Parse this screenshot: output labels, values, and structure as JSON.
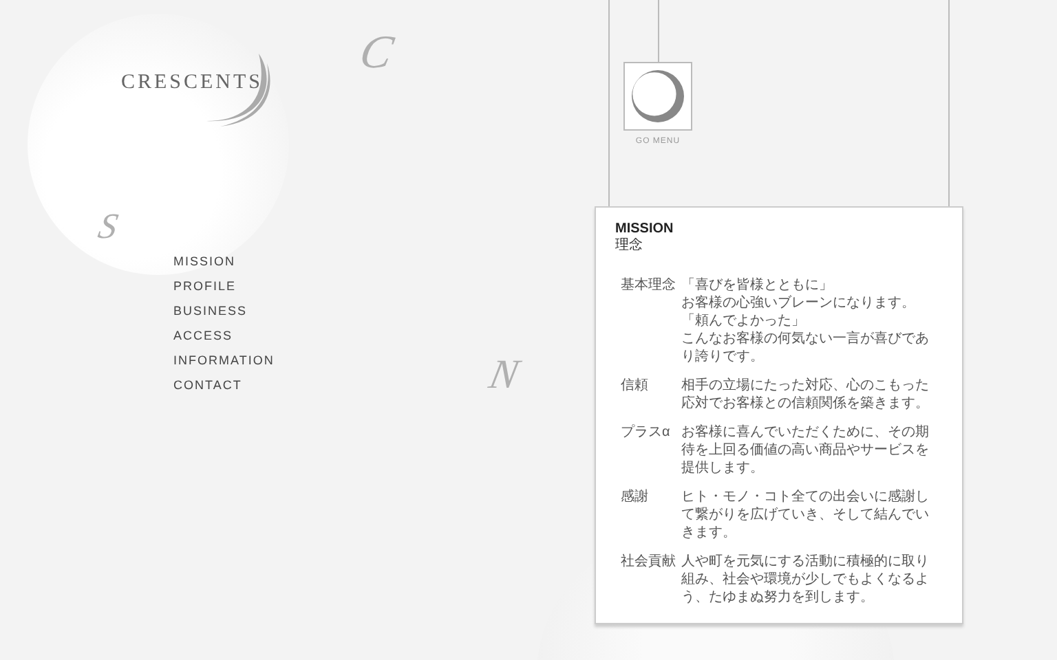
{
  "logo": {
    "text": "CRESCENTS"
  },
  "decor_letters": [
    {
      "letter": "C",
      "kind": "c"
    },
    {
      "letter": "S",
      "kind": "s"
    },
    {
      "letter": "N",
      "kind": "n"
    }
  ],
  "nav": [
    {
      "label": "MISSION"
    },
    {
      "label": "PROFILE"
    },
    {
      "label": "BUSINESS"
    },
    {
      "label": "ACCESS"
    },
    {
      "label": "INFORMATION"
    },
    {
      "label": "CONTACT"
    }
  ],
  "menu_button": {
    "label": "GO MENU"
  },
  "card": {
    "title": "MISSION",
    "subtitle": "理念",
    "rows": [
      {
        "label": "基本理念",
        "lines": [
          "「喜びを皆様とともに」",
          "お客様の心強いブレーンになります。",
          "「頼んでよかった」",
          "こんなお客様の何気ない一言が喜びであり誇りです。"
        ]
      },
      {
        "label": "信頼",
        "lines": [
          "相手の立場にたった対応、心のこもった応対でお客様との信頼関係を築きます。"
        ]
      },
      {
        "label": "プラスα",
        "lines": [
          "お客様に喜んでいただくために、その期待を上回る価値の高い商品やサービスを提供します。"
        ]
      },
      {
        "label": "感謝",
        "lines": [
          "ヒト・モノ・コト全ての出会いに感謝して繋がりを広げていき、そして結んでいきます。"
        ]
      },
      {
        "label": "社会貢献",
        "lines": [
          "人や町を元気にする活動に積極的に取り組み、社会や環境が少しでもよくなるよう、たゆまぬ努力を到します。"
        ]
      }
    ]
  }
}
